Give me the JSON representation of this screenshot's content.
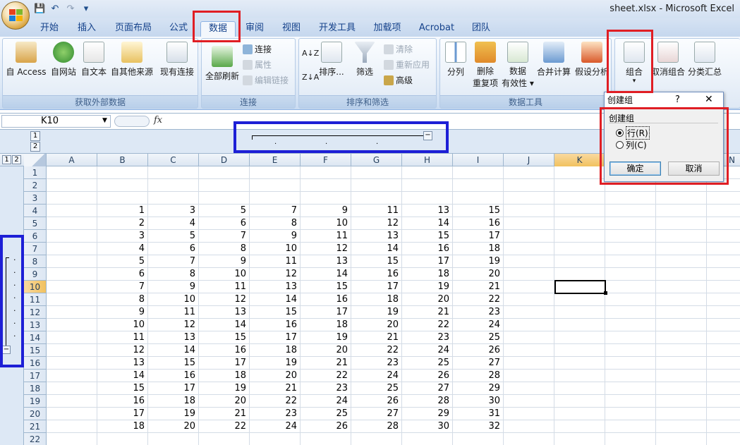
{
  "window": {
    "title": "sheet.xlsx - Microsoft Excel"
  },
  "qat": {
    "icons": [
      "save-icon",
      "undo-icon",
      "redo-icon",
      "customize-qat-icon"
    ]
  },
  "tabs": [
    "开始",
    "插入",
    "页面布局",
    "公式",
    "数据",
    "审阅",
    "视图",
    "开发工具",
    "加载项",
    "Acrobat",
    "团队"
  ],
  "active_tab": "数据",
  "ribbon": {
    "groups": {
      "external": {
        "label": "获取外部数据",
        "buttons": [
          "自 Access",
          "自网站",
          "自文本",
          "自其他来源",
          "现有连接"
        ]
      },
      "connections": {
        "label": "连接",
        "refresh": "全部刷新",
        "items": [
          "连接",
          "属性",
          "编辑链接"
        ]
      },
      "sort": {
        "label": "排序和筛选",
        "sort": "排序...",
        "filter": "筛选",
        "items": [
          "清除",
          "重新应用",
          "高级"
        ]
      },
      "tools": {
        "label": "数据工具",
        "split": "分列",
        "dedupe1": "删除",
        "dedupe2": "重复项",
        "valid1": "数据",
        "valid2": "有效性",
        "consolidate": "合并计算",
        "whatif": "假设分析"
      },
      "outline": {
        "group": "组合",
        "ungroup": "取消组合",
        "subtotal": "分类汇总"
      }
    }
  },
  "formula_bar": {
    "name_box": "K10",
    "fx": "fx",
    "value": ""
  },
  "outline": {
    "col_levels": [
      "1",
      "2"
    ],
    "row_levels": [
      "1",
      "2"
    ],
    "collapse": "−"
  },
  "columns": [
    "A",
    "B",
    "C",
    "D",
    "E",
    "F",
    "G",
    "H",
    "I",
    "J",
    "K",
    "L",
    "M",
    "N"
  ],
  "selected_column": "K",
  "rows": [
    "1",
    "2",
    "3",
    "4",
    "5",
    "6",
    "7",
    "8",
    "9",
    "10",
    "11",
    "12",
    "13",
    "14",
    "15",
    "16",
    "17",
    "18",
    "19",
    "20",
    "21",
    "22"
  ],
  "selected_row": "10",
  "selected_cell": "K10",
  "table": [
    [
      1,
      3,
      5,
      7,
      9,
      11,
      13,
      15
    ],
    [
      2,
      4,
      6,
      8,
      10,
      12,
      14,
      16
    ],
    [
      3,
      5,
      7,
      9,
      11,
      13,
      15,
      17
    ],
    [
      4,
      6,
      8,
      10,
      12,
      14,
      16,
      18
    ],
    [
      5,
      7,
      9,
      11,
      13,
      15,
      17,
      19
    ],
    [
      6,
      8,
      10,
      12,
      14,
      16,
      18,
      20
    ],
    [
      7,
      9,
      11,
      13,
      15,
      17,
      19,
      21
    ],
    [
      8,
      10,
      12,
      14,
      16,
      18,
      20,
      22
    ],
    [
      9,
      11,
      13,
      15,
      17,
      19,
      21,
      23
    ],
    [
      10,
      12,
      14,
      16,
      18,
      20,
      22,
      24
    ],
    [
      11,
      13,
      15,
      17,
      19,
      21,
      23,
      25
    ],
    [
      12,
      14,
      16,
      18,
      20,
      22,
      24,
      26
    ],
    [
      13,
      15,
      17,
      19,
      21,
      23,
      25,
      27
    ],
    [
      14,
      16,
      18,
      20,
      22,
      24,
      26,
      28
    ],
    [
      15,
      17,
      19,
      21,
      23,
      25,
      27,
      29
    ],
    [
      16,
      18,
      20,
      22,
      24,
      26,
      28,
      30
    ],
    [
      17,
      19,
      21,
      23,
      25,
      27,
      29,
      31
    ],
    [
      18,
      20,
      22,
      24,
      26,
      28,
      30,
      32
    ]
  ],
  "dialog": {
    "title": "创建组",
    "help": "?",
    "close": "✕",
    "section": "创建组",
    "row_option": "行(R)",
    "col_option": "列(C)",
    "selected": "row",
    "ok": "确定",
    "cancel": "取消"
  },
  "colors": {
    "highlight_red": "#e01e24",
    "highlight_blue": "#1d1fd6",
    "selected_header": "#f1c15f"
  }
}
